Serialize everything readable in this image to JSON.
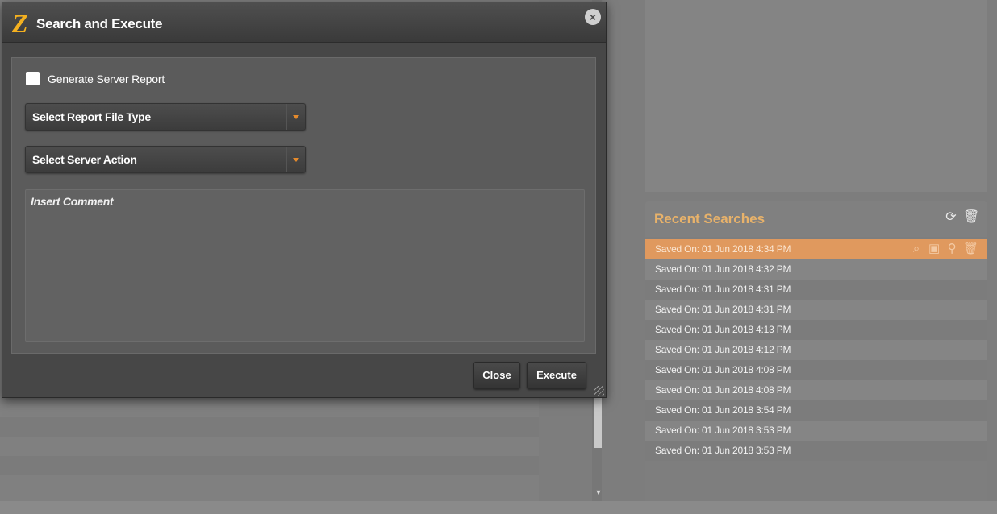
{
  "dialog": {
    "title": "Search and Execute",
    "logo_glyph": "Z",
    "close_glyph": "×",
    "generate_report_label": "Generate Server Report",
    "generate_report_checked": false,
    "report_file_type": "Select Report File Type",
    "server_action": "Select Server Action",
    "comment_placeholder": "Insert Comment",
    "close_label": "Close",
    "execute_label": "Execute"
  },
  "recent": {
    "title": "Recent Searches",
    "refresh_glyph": "⟳",
    "delete_glyph": "🗑",
    "item_actions": {
      "search_edit_glyph": "⌕",
      "save_glyph": "▣",
      "search_glyph": "⚲",
      "delete_glyph": "🗑"
    },
    "items": [
      "Saved On: 01 Jun 2018 4:34 PM",
      "Saved On: 01 Jun 2018 4:32 PM",
      "Saved On: 01 Jun 2018 4:31 PM",
      "Saved On: 01 Jun 2018 4:31 PM",
      "Saved On: 01 Jun 2018 4:13 PM",
      "Saved On: 01 Jun 2018 4:12 PM",
      "Saved On: 01 Jun 2018 4:08 PM",
      "Saved On: 01 Jun 2018 4:08 PM",
      "Saved On: 01 Jun 2018 3:54 PM",
      "Saved On: 01 Jun 2018 3:53 PM",
      "Saved On: 01 Jun 2018 3:53 PM"
    ],
    "active_index": 0
  },
  "scrollbar": {
    "arrow_glyph": "▼"
  },
  "colors": {
    "accent_orange": "#e0995e",
    "title_gold": "#e8b26a",
    "dropdown_arrow": "#e58a2c"
  }
}
